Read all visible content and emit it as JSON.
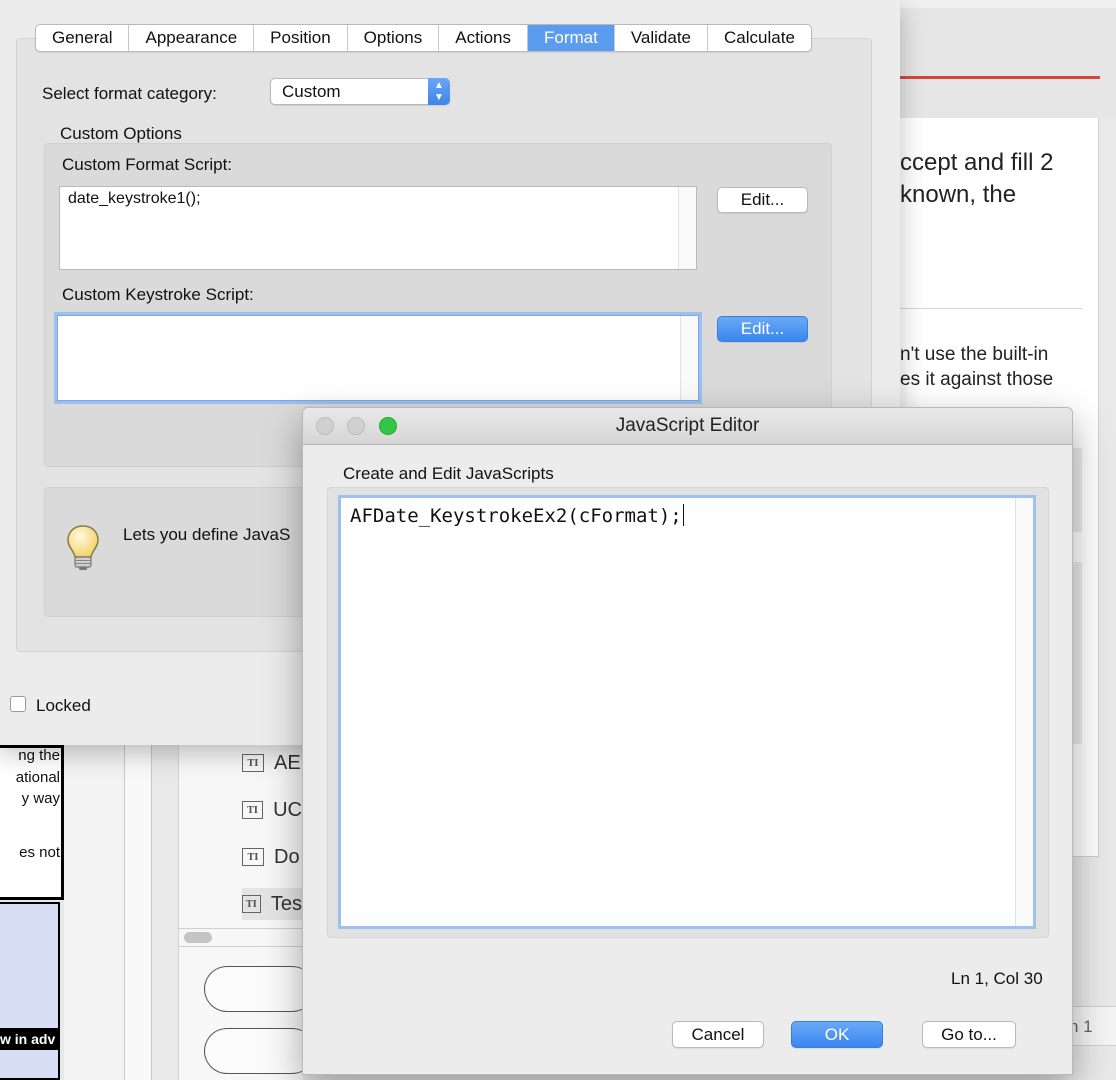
{
  "background": {
    "doc_text_top": [
      "ccept and fill 2",
      "known, the"
    ],
    "doc_text_mid": [
      "n't use the built-in",
      "es it against those"
    ],
    "page_field": "n 1",
    "left_page_lines": [
      "ng the",
      "ational",
      "y way",
      "",
      "es not"
    ],
    "left_label": "w in adv",
    "field_list": [
      {
        "badge": "T|",
        "text": "AE"
      },
      {
        "badge": "T|",
        "text": "UC"
      },
      {
        "badge": "T|",
        "text": "Do"
      },
      {
        "badge": "T|",
        "text": "Tes"
      }
    ]
  },
  "properties_dialog": {
    "tabs": [
      "General",
      "Appearance",
      "Position",
      "Options",
      "Actions",
      "Format",
      "Validate",
      "Calculate"
    ],
    "active_tab": "Format",
    "format_category_label": "Select format category:",
    "format_category_value": "Custom",
    "custom_options_label": "Custom Options",
    "format_script_label": "Custom Format Script:",
    "format_script_value": "date_keystroke1();",
    "keystroke_script_label": "Custom Keystroke Script:",
    "keystroke_script_value": "",
    "edit_label": "Edit...",
    "info_text": "Lets you define JavaS",
    "locked_label": "Locked",
    "locked_checked": false
  },
  "js_editor": {
    "title": "JavaScript Editor",
    "group_label": "Create and Edit JavaScripts",
    "code": "AFDate_KeystrokeEx2(cFormat);",
    "position": "Ln 1, Col 30",
    "cancel_label": "Cancel",
    "ok_label": "OK",
    "goto_label": "Go to..."
  },
  "colors": {
    "accent": "#5b9cf1",
    "focus_ring": "#9ec0ef",
    "traffic_green": "#35c648",
    "doc_red": "#d9453d"
  }
}
